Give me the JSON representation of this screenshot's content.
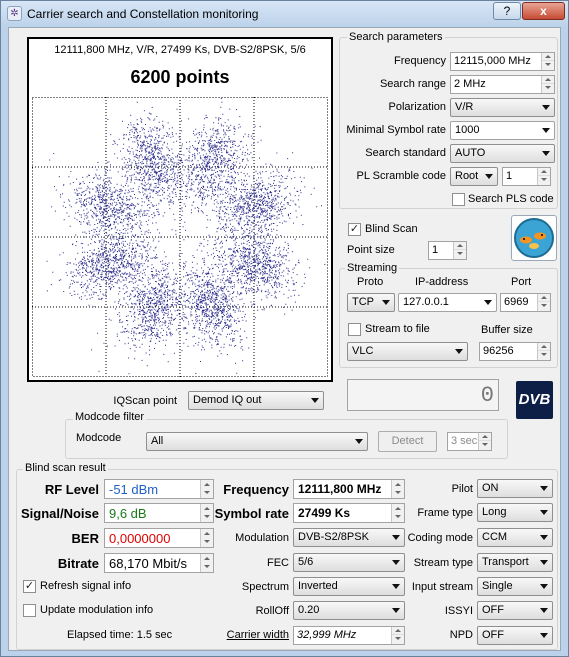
{
  "window": {
    "title": "Carrier search and Constellation monitoring",
    "help_label": "?",
    "close_label": "x"
  },
  "constellation": {
    "info": "12111,800 MHz, V/R, 27499 Ks, DVB-S2/8PSK, 5/6",
    "points_label": "6200 points",
    "point_count": 6200,
    "dot_color": "#2c2c8c"
  },
  "search_parameters": {
    "title": "Search parameters",
    "frequency_label": "Frequency",
    "frequency": "12115,000 MHz",
    "search_range_label": "Search range",
    "search_range": "2 MHz",
    "polarization_label": "Polarization",
    "polarization": "V/R",
    "min_symbol_rate_label": "Minimal Symbol rate",
    "min_symbol_rate": "1000",
    "search_standard_label": "Search standard",
    "search_standard": "AUTO",
    "pl_scramble_label": "PL Scramble code",
    "pl_scramble_mode": "Root",
    "pl_scramble_value": "1",
    "search_pls_label": "Search PLS code",
    "search_pls_checked": false
  },
  "blind_scan": {
    "label": "Blind Scan",
    "checked": true,
    "point_size_label": "Point size",
    "point_size": "1"
  },
  "streaming": {
    "title": "Streaming",
    "proto_label": "Proto",
    "ip_label": "IP-address",
    "port_label": "Port",
    "proto": "TCP",
    "ip": "127.0.0.1",
    "port": "6969",
    "stream_to_file_label": "Stream to file",
    "stream_to_file_checked": false,
    "buffer_size_label": "Buffer size",
    "player": "VLC",
    "buffer_size": "96256"
  },
  "iqscan": {
    "label": "IQScan point",
    "value": "Demod IQ out",
    "counter": "0",
    "logo_text": "DVB"
  },
  "modcode_filter": {
    "title": "Modcode filter",
    "modcode_label": "Modcode",
    "modcode": "All",
    "detect_label": "Detect",
    "seconds": "3 sec"
  },
  "result": {
    "title": "Blind scan result",
    "rf_level_label": "RF Level",
    "rf_level": "-51 dBm",
    "snr_label": "Signal/Noise",
    "snr": "9,6 dB",
    "ber_label": "BER",
    "ber": "0,0000000",
    "bitrate_label": "Bitrate",
    "bitrate": "68,170 Mbit/s",
    "refresh_label": "Refresh signal info",
    "refresh_checked": true,
    "update_mod_label": "Update modulation info",
    "update_mod_checked": false,
    "elapsed": "Elapsed time: 1.5 sec",
    "frequency_label": "Frequency",
    "frequency": "12111,800 MHz",
    "symbol_rate_label": "Symbol rate",
    "symbol_rate": "27499 Ks",
    "modulation_label": "Modulation",
    "modulation": "DVB-S2/8PSK",
    "fec_label": "FEC",
    "fec": "5/6",
    "spectrum_label": "Spectrum",
    "spectrum": "Inverted",
    "rolloff_label": "RollOff",
    "rolloff": "0.20",
    "carrier_width_label": "Carrier width",
    "carrier_width": "32,999 MHz",
    "pilot_label": "Pilot",
    "pilot": "ON",
    "frame_type_label": "Frame type",
    "frame_type": "Long",
    "coding_mode_label": "Coding mode",
    "coding_mode": "CCM",
    "stream_type_label": "Stream type",
    "stream_type": "Transport",
    "input_stream_label": "Input stream",
    "input_stream": "Single",
    "issyi_label": "ISSYI",
    "issyi": "OFF",
    "npd_label": "NPD",
    "npd": "OFF"
  },
  "colors": {
    "rf_level": "#1f5fc7",
    "snr": "#1a7a1a",
    "ber": "#e00000"
  }
}
